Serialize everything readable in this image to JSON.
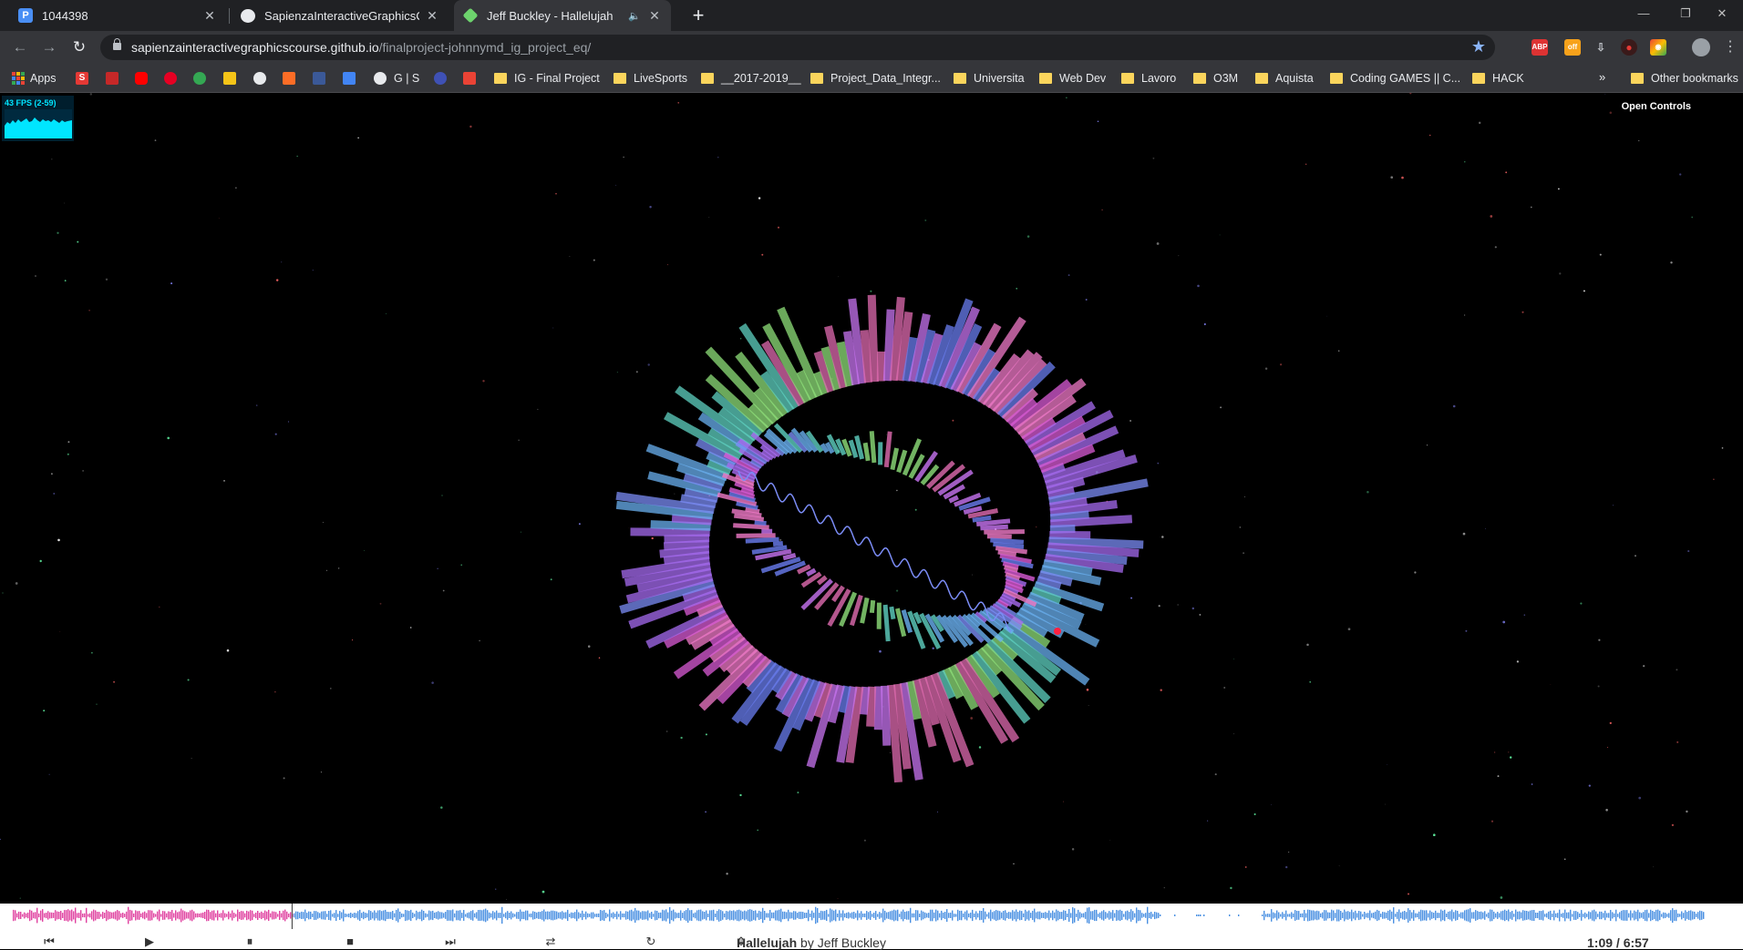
{
  "browser": {
    "tabs": [
      {
        "title": "1044398",
        "favicon": "pinterest-style-icon",
        "favicon_letter": "P",
        "favicon_color": "#4a8ff5"
      },
      {
        "title": "SapienzaInteractiveGraphicsCour",
        "favicon": "github-icon"
      },
      {
        "title": "Jeff Buckley - Hallelujah",
        "favicon": "threejs-cube-icon",
        "favicon_color": "#6dd36d",
        "audio_icon": "speaker-icon"
      }
    ],
    "new_tab": "+",
    "window_controls": {
      "minimize": "—",
      "restore": "❐",
      "close": "✕"
    },
    "address": {
      "host": "sapienzainteractivegraphicscourse.github.io",
      "path": "/finalproject-johnnymd_ig_project_eq/"
    },
    "extensions": [
      {
        "name": "adblock-plus-icon",
        "label": "ABP",
        "color": "#d33"
      },
      {
        "name": "off-badge-icon",
        "label": "off",
        "color": "#f7a21b"
      },
      {
        "name": "download-icon",
        "label": "⇩",
        "color": "#5f6368"
      },
      {
        "name": "record-icon",
        "label": "●",
        "color": "#c62828"
      },
      {
        "name": "chrome-ext-icon",
        "label": "◉",
        "color": "#34a853"
      }
    ],
    "bookmarks": [
      {
        "label": "Apps",
        "type": "apps"
      },
      {
        "label": "",
        "type": "icon",
        "color": "#e53935",
        "letter": "S"
      },
      {
        "label": "",
        "type": "icon",
        "color": "#c62828",
        "letter": "❧"
      },
      {
        "label": "",
        "type": "icon",
        "color": "#ff0000",
        "letter": "▶"
      },
      {
        "label": "",
        "type": "icon",
        "color": "#e60023",
        "letter": "P"
      },
      {
        "label": "",
        "type": "icon",
        "color": "#34a853",
        "letter": "▶"
      },
      {
        "label": "",
        "type": "icon",
        "color": "#f5c518",
        "letter": "M"
      },
      {
        "label": "",
        "type": "icon",
        "color": "#e8eaed",
        "letter": ""
      },
      {
        "label": "",
        "type": "icon",
        "color": "#fc6d26",
        "letter": ""
      },
      {
        "label": "",
        "type": "icon",
        "color": "#3b5998",
        "letter": "f"
      },
      {
        "label": "",
        "type": "icon",
        "color": "#4285f4",
        "letter": "G"
      },
      {
        "label": "G | S",
        "type": "icon",
        "color": "#e8eaed",
        "letter": ""
      },
      {
        "label": "",
        "type": "icon",
        "color": "#3f51b5",
        "letter": "@"
      },
      {
        "label": "",
        "type": "icon",
        "color": "#ea4335",
        "letter": "M"
      },
      {
        "label": "IG - Final Project",
        "type": "folder"
      },
      {
        "label": "LiveSports",
        "type": "folder"
      },
      {
        "label": "__2017-2019__",
        "type": "folder"
      },
      {
        "label": "Project_Data_Integr...",
        "type": "folder"
      },
      {
        "label": "Universita",
        "type": "folder"
      },
      {
        "label": "Web Dev",
        "type": "folder"
      },
      {
        "label": "Lavoro",
        "type": "folder"
      },
      {
        "label": "O3M",
        "type": "folder"
      },
      {
        "label": "Aquista",
        "type": "folder"
      },
      {
        "label": "Coding GAMES || C...",
        "type": "folder"
      },
      {
        "label": "HACK",
        "type": "folder"
      }
    ],
    "bookmarks_overflow": "»",
    "other_bookmarks": "Other bookmarks"
  },
  "scene": {
    "fps_label": "43 FPS (2-59)",
    "open_controls": "Open Controls"
  },
  "player": {
    "colors": {
      "played": "#e040a0",
      "unplayed": "#4a90e2"
    },
    "progress": 0.166,
    "track_title": "Hallelujah",
    "track_by": "by",
    "track_artist": "Jeff Buckley",
    "time": "1:09 / 6:57",
    "controls": [
      {
        "name": "previous-track-button",
        "glyph": "⏮"
      },
      {
        "name": "play-button",
        "glyph": "▶"
      },
      {
        "name": "pause-button",
        "glyph": "⏸"
      },
      {
        "name": "stop-button",
        "glyph": "■"
      },
      {
        "name": "next-track-button",
        "glyph": "⏭"
      },
      {
        "name": "shuffle-button",
        "glyph": "⇄"
      },
      {
        "name": "repeat-button",
        "glyph": "↻"
      },
      {
        "name": "playlist-toggle-button",
        "glyph": "⇕"
      }
    ]
  }
}
